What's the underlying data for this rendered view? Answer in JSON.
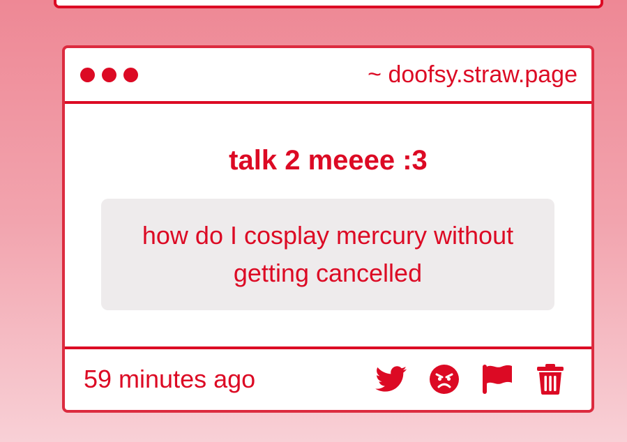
{
  "card": {
    "domain": "~ doofsy.straw.page",
    "heading": "talk 2 meeee :3",
    "message": "how do I cosplay mercury without getting cancelled",
    "timestamp": "59 minutes ago"
  },
  "actions": [
    {
      "icon": "twitter-icon"
    },
    {
      "icon": "angry-face-icon"
    },
    {
      "icon": "flag-icon"
    },
    {
      "icon": "trash-icon"
    }
  ],
  "colors": {
    "accent": "#dc0a24",
    "message_bg": "#eeebec",
    "background_top": "#ee8895",
    "background_bottom": "#f8d0d6"
  }
}
